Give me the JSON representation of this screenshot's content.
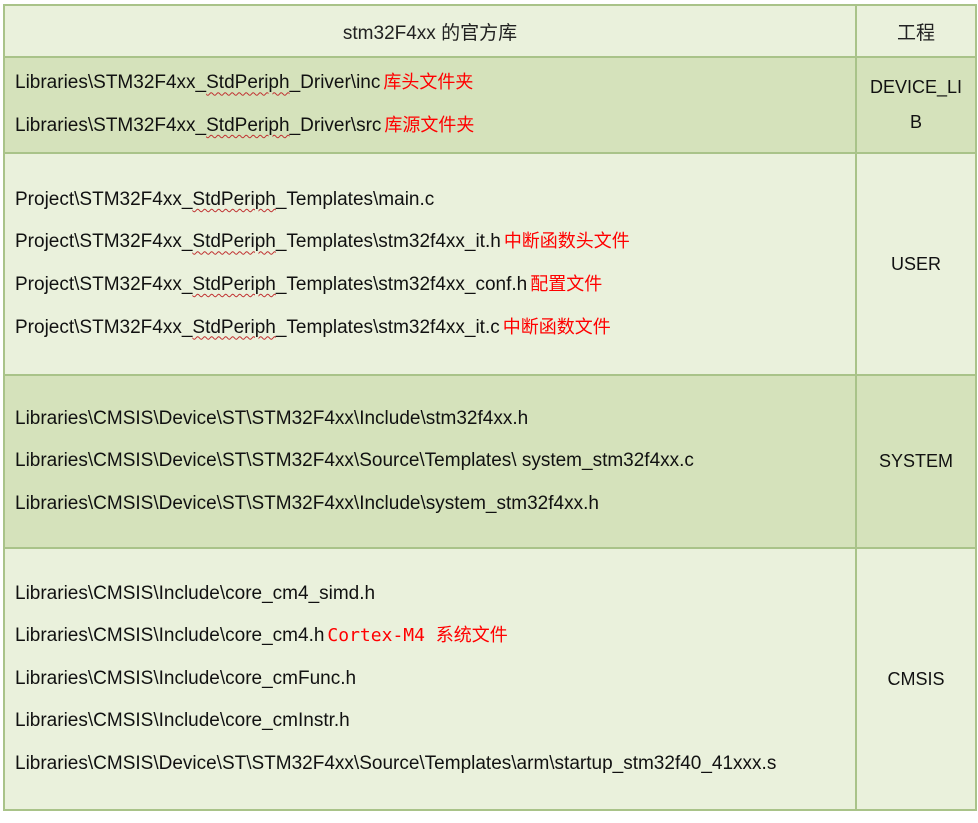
{
  "header": {
    "left": "stm32F4xx 的官方库",
    "right": "工程"
  },
  "groups": [
    {
      "project": "DEVICE_LIB",
      "project_lines": [
        "DEVICE_LI",
        "B"
      ],
      "files": [
        {
          "path": "Libraries\\STM32F4xx_StdPeriph_Driver\\inc",
          "note": "库头文件夹"
        },
        {
          "path": "Libraries\\STM32F4xx_StdPeriph_Driver\\src",
          "note": "库源文件夹"
        }
      ]
    },
    {
      "project": "USER",
      "files": [
        {
          "path": "Project\\STM32F4xx_StdPeriph_Templates\\main.c",
          "note": ""
        },
        {
          "path": "Project\\STM32F4xx_StdPeriph_Templates\\stm32f4xx_it.h",
          "note": "中断函数头文件"
        },
        {
          "path": "Project\\STM32F4xx_StdPeriph_Templates\\stm32f4xx_conf.h",
          "note": "配置文件"
        },
        {
          "path": "Project\\STM32F4xx_StdPeriph_Templates\\stm32f4xx_it.c",
          "note": "中断函数文件"
        }
      ]
    },
    {
      "project": "SYSTEM",
      "files": [
        {
          "path": "Libraries\\CMSIS\\Device\\ST\\STM32F4xx\\Include\\stm32f4xx.h",
          "note": ""
        },
        {
          "path": "Libraries\\CMSIS\\Device\\ST\\STM32F4xx\\Source\\Templates\\ system_stm32f4xx.c",
          "note": ""
        },
        {
          "path": "Libraries\\CMSIS\\Device\\ST\\STM32F4xx\\Include\\system_stm32f4xx.h",
          "note": ""
        }
      ]
    },
    {
      "project": "CMSIS",
      "files": [
        {
          "path": "Libraries\\CMSIS\\Include\\core_cm4_simd.h",
          "note": ""
        },
        {
          "path": "Libraries\\CMSIS\\Include\\core_cm4.h",
          "note": "Cortex-M4 系统文件"
        },
        {
          "path": "Libraries\\CMSIS\\Include\\core_cmFunc.h",
          "note": ""
        },
        {
          "path": "Libraries\\CMSIS\\Include\\core_cmInstr.h",
          "note": ""
        },
        {
          "path": "Libraries\\CMSIS\\Device\\ST\\STM32F4xx\\Source\\Templates\\arm\\startup_stm32f40_41xxx.s",
          "note": ""
        }
      ]
    }
  ],
  "colors": {
    "light_row": "#eaf1dc",
    "dark_row": "#d5e2bb",
    "border": "#a9c389",
    "note_text": "#ff0000"
  }
}
